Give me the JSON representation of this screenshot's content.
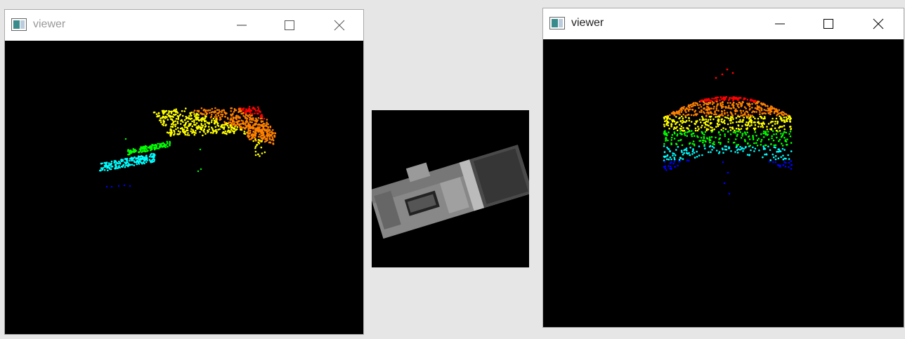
{
  "windows": [
    {
      "title": "viewer",
      "state": "inactive",
      "icon": "app-window-icon",
      "controls": {
        "minimize": "minimize-icon",
        "maximize": "maximize-icon",
        "close": "close-icon"
      }
    },
    {
      "title": "viewer",
      "state": "active",
      "icon": "app-window-icon",
      "controls": {
        "minimize": "minimize-icon",
        "maximize": "maximize-icon",
        "close": "close-icon"
      }
    }
  ],
  "colors": {
    "desktop": "#e6e6e6",
    "viewport_background": "#000000",
    "inactive_title": "#999999",
    "active_title": "#222222",
    "colormap": [
      "#0000ff",
      "#00ffff",
      "#00ff00",
      "#ffff00",
      "#ff8000",
      "#ff0000"
    ]
  },
  "center_image": {
    "type": "grayscale aerial photograph of a rooftop"
  }
}
